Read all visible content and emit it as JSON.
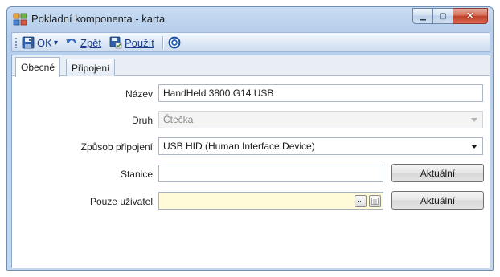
{
  "window": {
    "title": "Pokladní komponenta - karta",
    "minimize_glyph": "▁",
    "maximize_glyph": "▢",
    "close_glyph": "✕"
  },
  "toolbar": {
    "ok_label": "OK",
    "ok_dropdown_glyph": "▾",
    "back_label": "Zpět",
    "apply_label": "Použít",
    "help_icon": "help-icon"
  },
  "tabs": [
    {
      "label": "Obecné",
      "active": true
    },
    {
      "label": "Připojení",
      "active": false
    }
  ],
  "form": {
    "name": {
      "label": "Název",
      "value": "HandHeld 3800 G14 USB"
    },
    "kind": {
      "label": "Druh",
      "value": "Čtečka"
    },
    "connection": {
      "label": "Způsob připojení",
      "value": "USB HID (Human Interface Device)"
    },
    "station": {
      "label": "Stanice",
      "value": "",
      "button": "Aktuální"
    },
    "user_only": {
      "label": "Pouze uživatel",
      "value": "",
      "ellipsis": "···",
      "button": "Aktuální"
    }
  },
  "colors": {
    "accent_blue": "#1a3e8a",
    "close_red": "#c2402a",
    "field_yellow": "#fffbd8"
  }
}
